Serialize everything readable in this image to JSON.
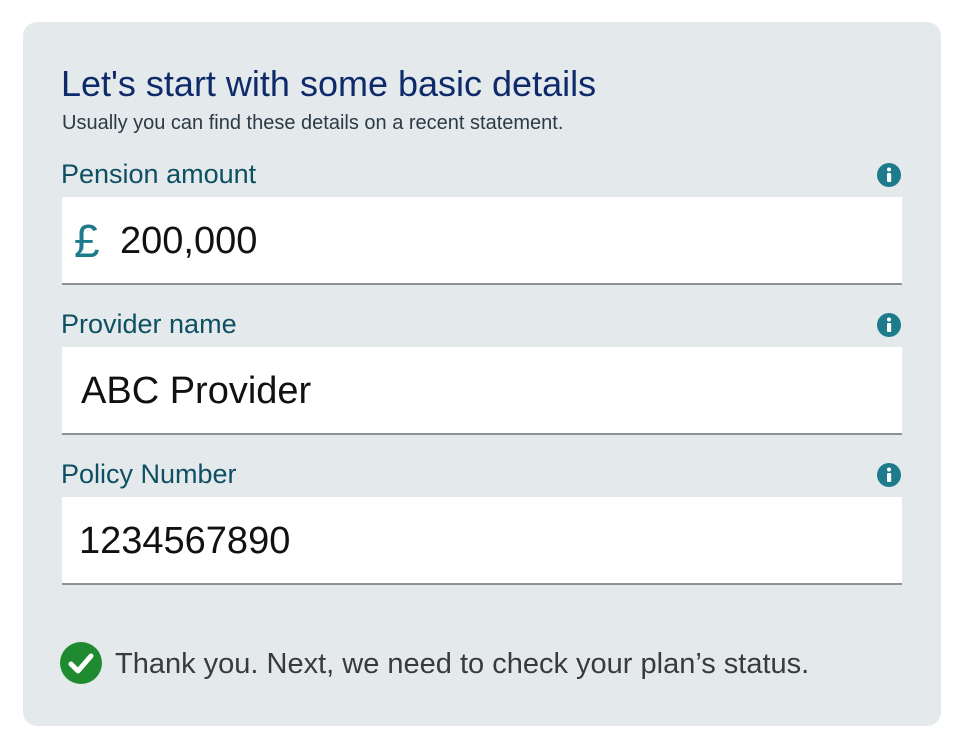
{
  "form": {
    "title": "Let's start with some basic details",
    "subtitle": "Usually you can find these details on a recent statement.",
    "fields": [
      {
        "label": "Pension amount",
        "prefix": "£",
        "value": "200,000",
        "info_icon": "info-icon"
      },
      {
        "label": "Provider name",
        "value": "ABC Provider",
        "info_icon": "info-icon"
      },
      {
        "label": "Policy Number",
        "value": "1234567890",
        "info_icon": "info-icon"
      }
    ],
    "status": {
      "icon": "check-circle-icon",
      "text": "Thank you. Next, we need to check your plan’s status."
    }
  },
  "colors": {
    "panel_background": "#e4eaec",
    "title": "#0f2a6b",
    "label": "#0e4f63",
    "accent": "#1e7b8c",
    "success": "#1f8a2f"
  }
}
